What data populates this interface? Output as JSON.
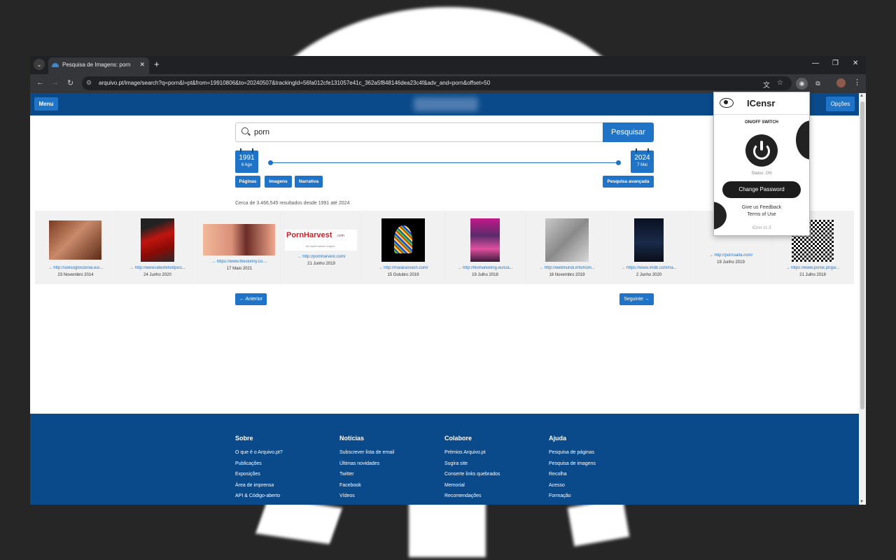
{
  "browser": {
    "tab_title": "Pesquisa de Imagens: porn",
    "url": "arquivo.pt/image/search?q=porn&l=pt&from=19910806&to=20240507&trackingId=56fa012cfe131057e41c_362a5f848146dea23c4f&adv_and=porn&offset=50"
  },
  "site": {
    "menu_label": "Menu",
    "options_label": "Opções",
    "search_value": "porn",
    "search_button": "Pesquisar",
    "from_year": "1991",
    "from_day": "6 Ago",
    "to_year": "2024",
    "to_day": "7 Mai",
    "type_buttons": [
      "Páginas",
      "Imagens",
      "Narrativa"
    ],
    "advanced_search": "Pesquisa avançada",
    "results_count": "Cerca de 3.466.545 resultados desde 1991 até 2024",
    "results": [
      {
        "url": "→ http://seksogloszenia.eu/...",
        "date": "23 Novembro 2014"
      },
      {
        "url": "→ http://www.latexfetishpics...",
        "date": "24 Junho 2020"
      },
      {
        "url": "→ https://www.theskinny.co....",
        "date": "17 Maio 2021"
      },
      {
        "url": "→ http://pornharvest.com/",
        "date": "21 Junho 2019",
        "logo": "PornHarvest",
        "logo_suffix": ".com",
        "logo_tagline": "the adult search engine"
      },
      {
        "url": "→ http://malaravision.com/",
        "date": "15 Outubro 2019"
      },
      {
        "url": "→ http://filomarketing.eu/Da...",
        "date": "19 Julho 2018"
      },
      {
        "url": "→ http://webmundi.info/hom...",
        "date": "16 Novembro 2019"
      },
      {
        "url": "→ https://www.imdb.com/na...",
        "date": "2 Junho 2020"
      },
      {
        "url": "→ http://pornoalfa.com/",
        "date": "19 Junho 2019"
      },
      {
        "url": "→ https://www.pcrisk.pt/gui...",
        "date": "21 Julho 2018"
      }
    ],
    "prev_label": "← Anterior",
    "next_label": "Seguinte →"
  },
  "footer": {
    "columns": [
      {
        "title": "Sobre",
        "links": [
          "O que é o Arquivo.pt?",
          "Publicações",
          "Exposições",
          "Área de imprensa",
          "API & Código-aberto"
        ]
      },
      {
        "title": "Notícias",
        "links": [
          "Subscrever lista de email",
          "Últimas novidades",
          "Twitter",
          "Facebook",
          "Vídeos"
        ]
      },
      {
        "title": "Colabore",
        "links": [
          "Prémios Arquivo.pt",
          "Sugira site",
          "Conserte links quebrados",
          "Memorial",
          "Recomendações"
        ]
      },
      {
        "title": "Ajuda",
        "links": [
          "Pesquisa de páginas",
          "Pesquisa de imagens",
          "Recolha",
          "Acesso",
          "Formação"
        ]
      }
    ]
  },
  "extension": {
    "title": "ICensr",
    "switch_label": "ON/OFF SWITCH",
    "status": "Status: ON",
    "change_password": "Change Password",
    "feedback": "Give us Feedback",
    "terms": "Terms of Use",
    "version": "iCnsr v1.3"
  },
  "colors": {
    "site_blue": "#0a4a8a",
    "button_blue": "#1f74c7",
    "browser_dark": "#202124"
  }
}
